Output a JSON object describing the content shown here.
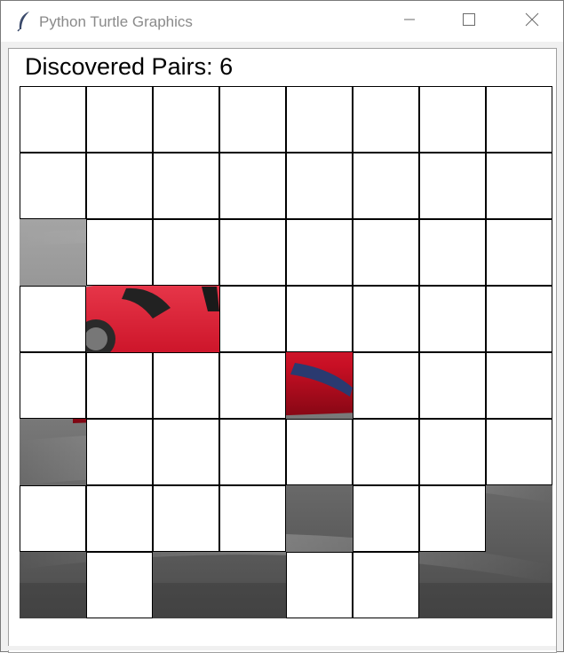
{
  "window": {
    "title": "Python Turtle Graphics",
    "icons": {
      "app": "feather-icon",
      "minimize": "minimize-icon",
      "maximize": "maximize-icon",
      "close": "close-icon"
    }
  },
  "game": {
    "score_text": "Discovered Pairs: 6",
    "grid": {
      "rows": 8,
      "cols": 8
    },
    "covered": [
      "11111111",
      "11111111",
      "01111111",
      "10011111",
      "11110111",
      "01111111",
      "11110110",
      "01001100"
    ],
    "colors": {
      "tile": "#ffffff",
      "tile_border": "#000000",
      "car_red": "#d1142a"
    }
  }
}
